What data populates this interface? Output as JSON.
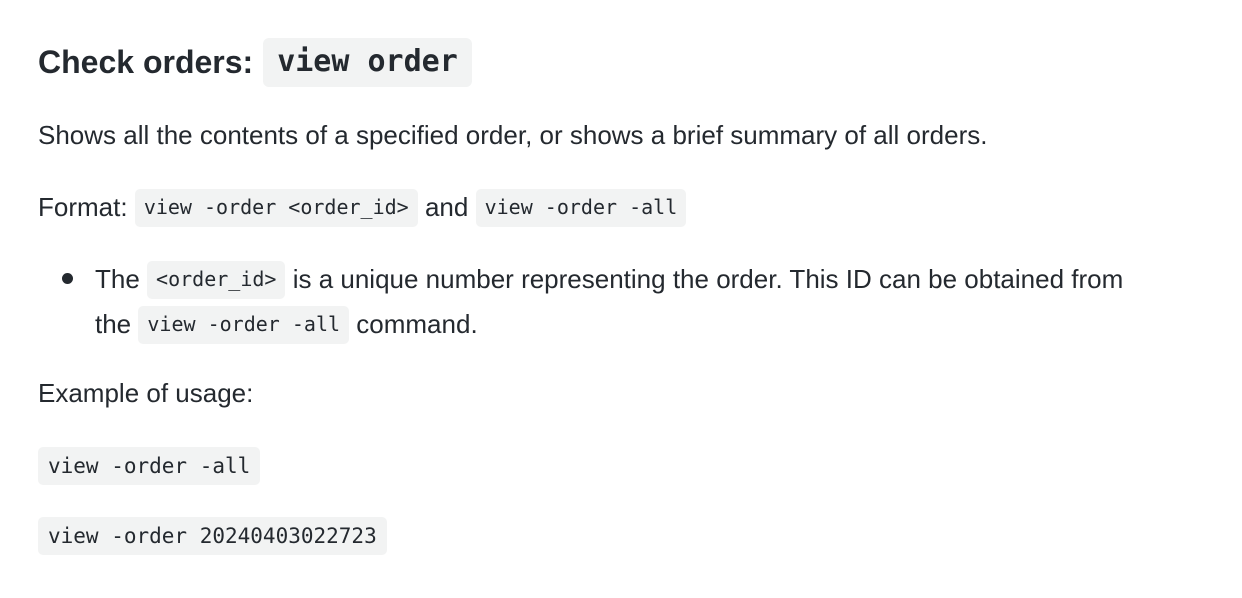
{
  "heading": {
    "text": "Check orders:",
    "code": "view order"
  },
  "description": "Shows all the contents of a specified order, or shows a brief summary of all orders.",
  "format": {
    "label": "Format:",
    "code1": "view -order <order_id>",
    "joiner": "and",
    "code2": "view -order -all"
  },
  "bullets": [
    {
      "text_before": "The",
      "code1": "<order_id>",
      "text_middle": "is a unique number representing the order. This ID can be obtained from",
      "text_line2_before": "the",
      "code2": "view -order -all",
      "text_after": "command."
    }
  ],
  "example_label": "Example of usage:",
  "examples": [
    "view -order -all",
    "view -order 20240403022723"
  ]
}
